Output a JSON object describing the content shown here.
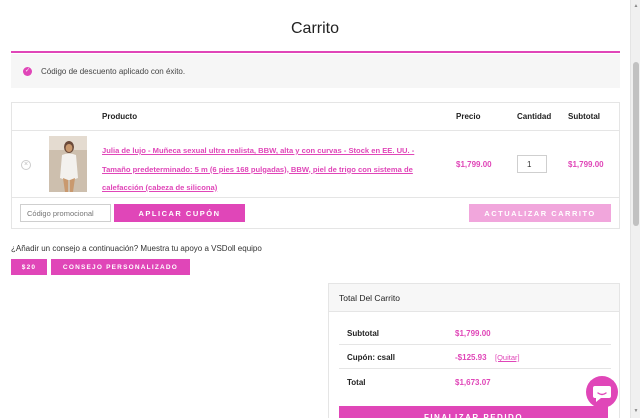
{
  "page": {
    "title": "Carrito"
  },
  "notice": {
    "icon": "check-circle-icon",
    "text": "Código de descuento aplicado con éxito."
  },
  "cart": {
    "headers": {
      "product": "Producto",
      "price": "Precio",
      "quantity": "Cantidad",
      "subtotal": "Subtotal"
    },
    "item": {
      "remove_glyph": "×",
      "name": "Julia de lujo - Muñeca sexual ultra realista, BBW, alta y con curvas - Stock en EE. UU. - Tamaño predeterminado: 5 m (6 pies 168 pulgadas), BBW, piel de trigo con sistema de calefacción (cabeza de silicona)",
      "price": "$1,799.00",
      "quantity": "1",
      "subtotal": "$1,799.00"
    },
    "coupon_placeholder": "Código promocional",
    "apply_button": "Aplicar cupón",
    "update_button": "Actualizar carrito"
  },
  "tip": {
    "text": "¿Añadir un consejo a continuación? Muestra tu apoyo a VSDoll equipo",
    "amount_button": "$20",
    "custom_button": "Consejo personalizado"
  },
  "totals": {
    "title": "Total Del Carrito",
    "subtotal_label": "Subtotal",
    "subtotal_value": "$1,799.00",
    "coupon_label": "Cupón: csall",
    "coupon_value": "-$125.93",
    "coupon_remove": "[Quitar]",
    "total_label": "Total",
    "total_value": "$1,673.07",
    "checkout_button": "Finalizar pedido"
  },
  "colors": {
    "accent": "#e046b8",
    "accent_light": "#f1a6dc"
  }
}
